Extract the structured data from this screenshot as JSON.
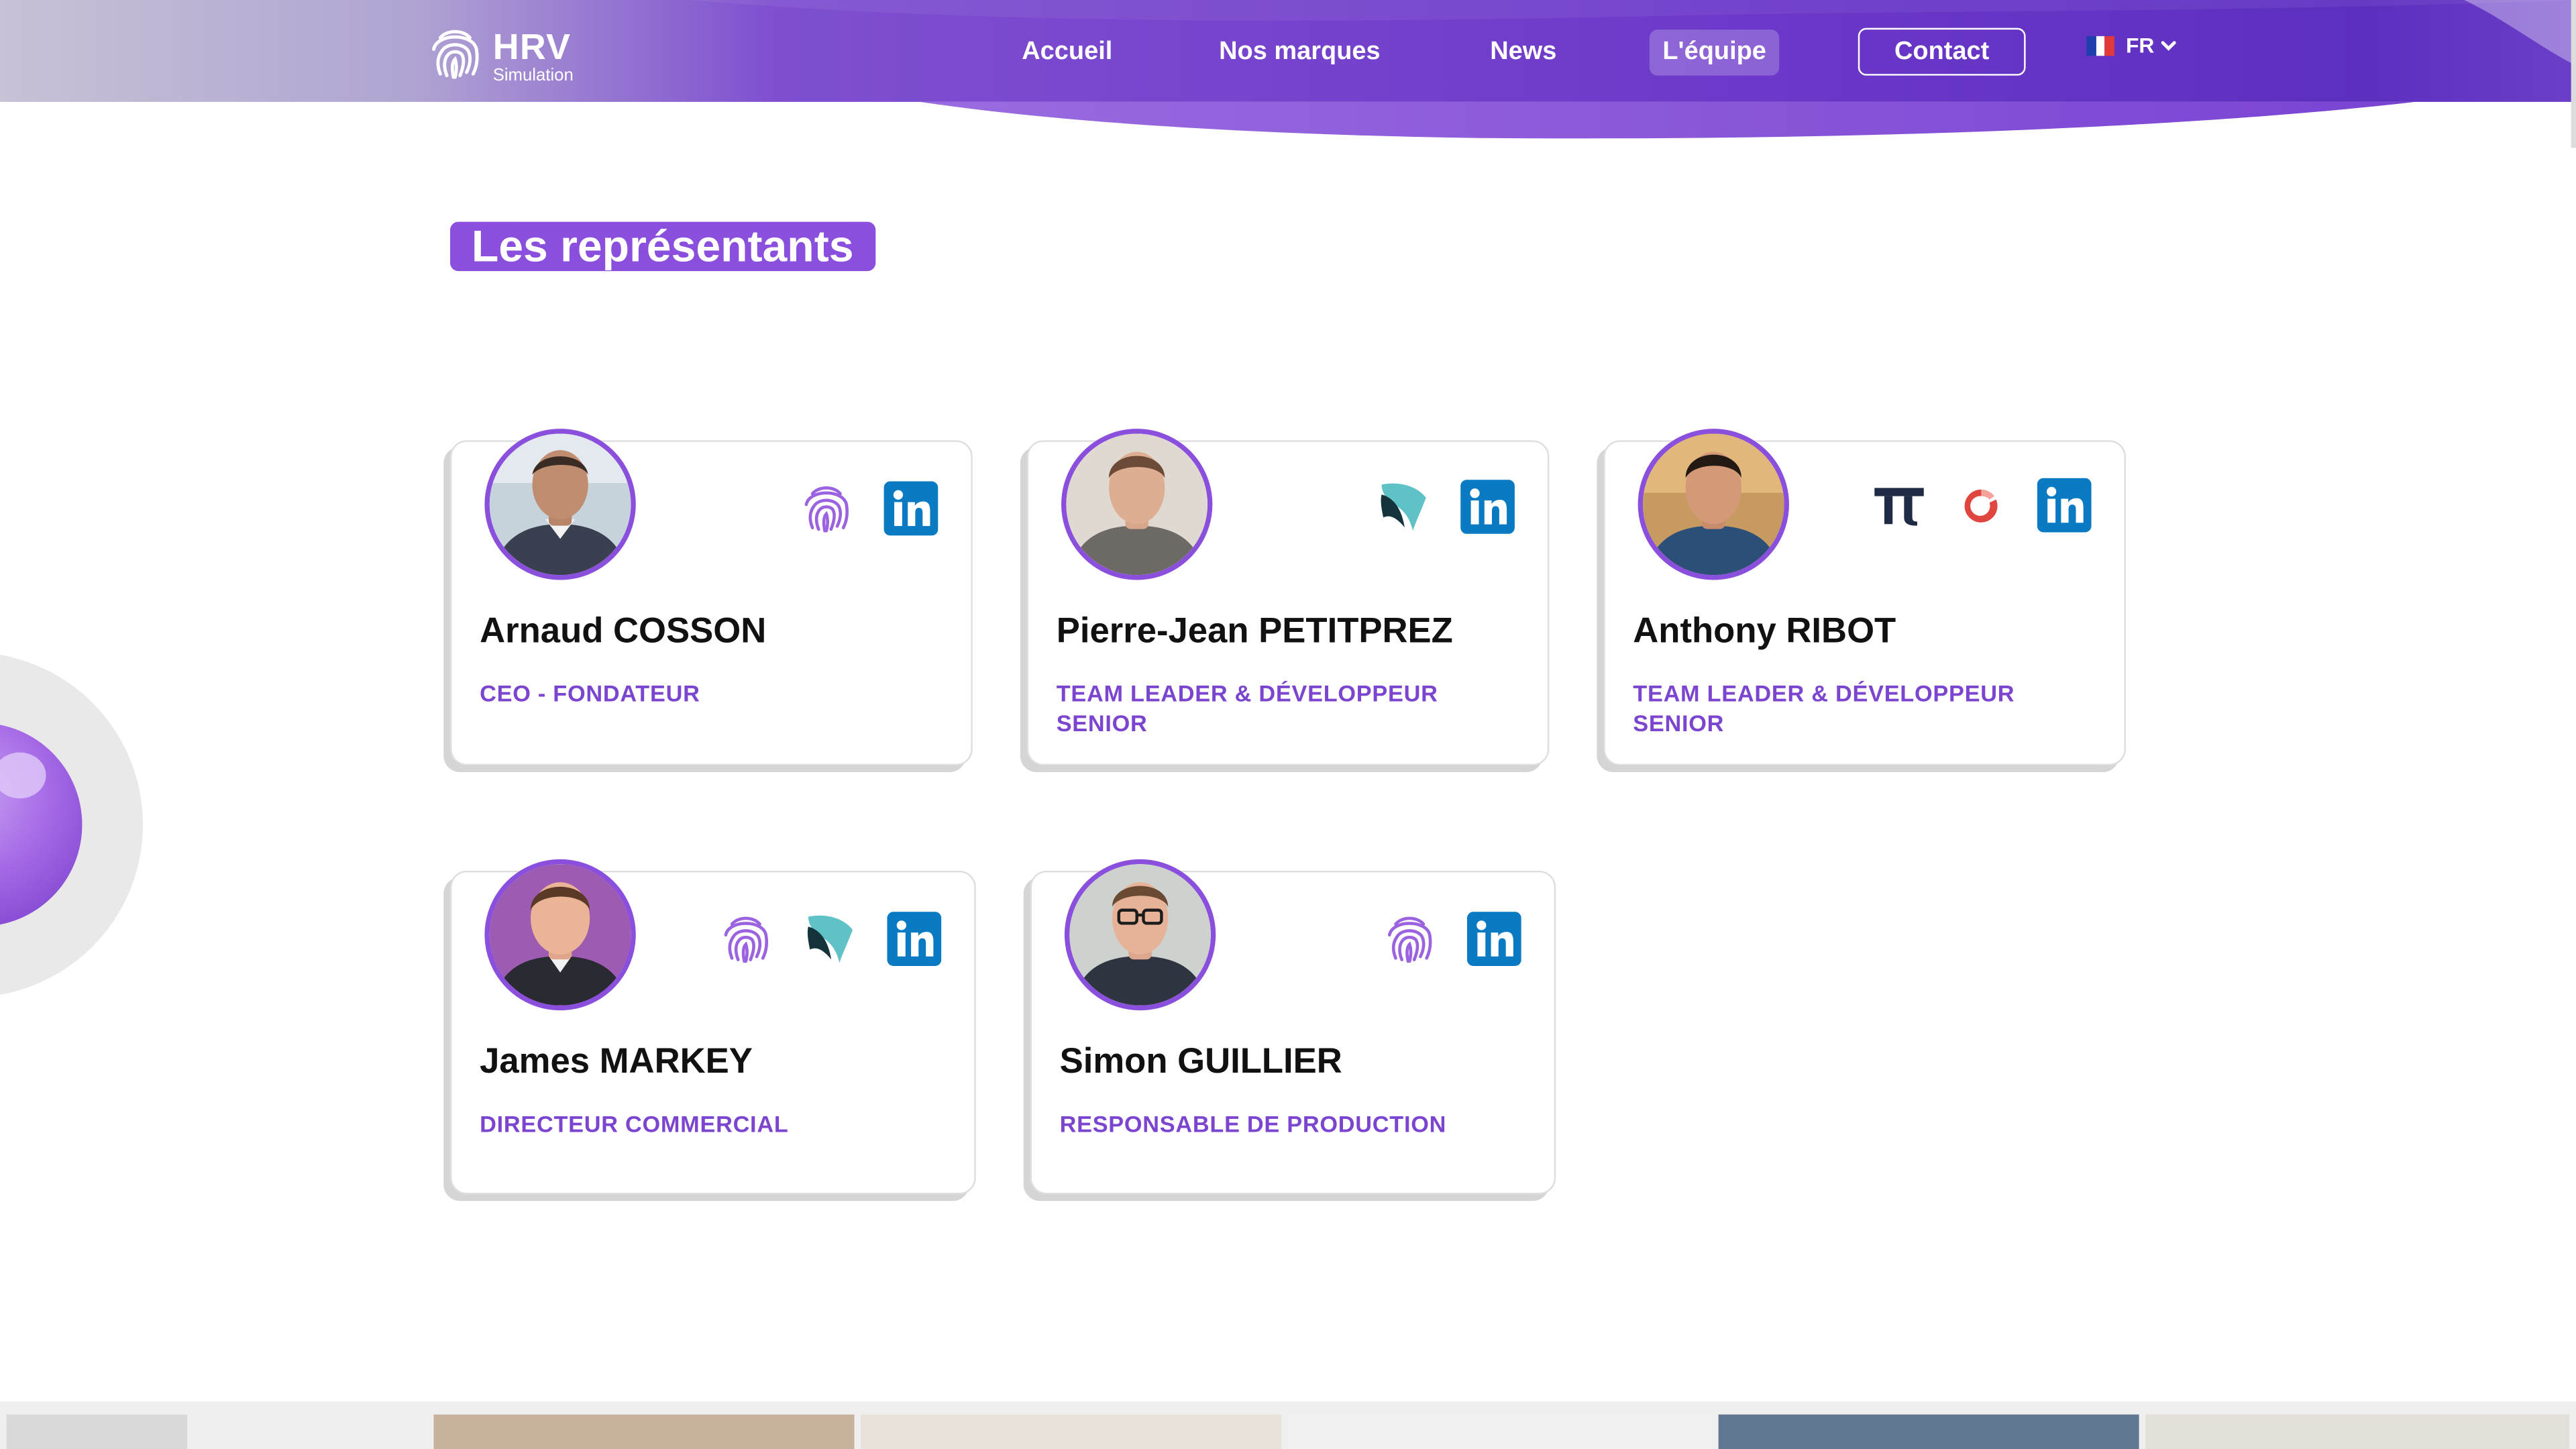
{
  "header": {
    "logo": {
      "main": "HRV",
      "sub": "Simulation",
      "icon": "fingerprint-icon"
    },
    "nav": {
      "home": "Accueil",
      "brands": "Nos marques",
      "news": "News",
      "team": "L'équipe",
      "contact": "Contact"
    },
    "language": {
      "code": "FR",
      "flag": "france-flag-icon",
      "chevron": "chevron-down-icon"
    }
  },
  "section": {
    "title": "Les représentants"
  },
  "members": [
    {
      "name": "Arnaud COSSON",
      "role": "CEO - FONDATEUR",
      "icons": [
        "fingerprint-icon",
        "linkedin-icon"
      ]
    },
    {
      "name": "Pierre-Jean PETITPREZ",
      "role": "TEAM LEADER & DÉVELOPPEUR SENIOR",
      "icons": [
        "shield-logo-icon",
        "linkedin-icon"
      ]
    },
    {
      "name": "Anthony RIBOT",
      "role": "TEAM LEADER & DÉVELOPPEUR SENIOR",
      "icons": [
        "pi-logo-icon",
        "swirl-logo-icon",
        "linkedin-icon"
      ]
    },
    {
      "name": "James MARKEY",
      "role": "DIRECTEUR COMMERCIAL",
      "icons": [
        "fingerprint-icon",
        "shield-logo-icon",
        "linkedin-icon"
      ]
    },
    {
      "name": "Simon GUILLIER",
      "role": "RESPONSABLE DE PRODUCTION",
      "icons": [
        "fingerprint-icon",
        "linkedin-icon"
      ]
    }
  ],
  "colors": {
    "brand": "#8a4fdc",
    "role_text": "#7b45cf",
    "header_purple": "#6a36c9",
    "linkedin": "#0a7ac2",
    "pi_logo": "#1f2a44",
    "swirl_logo": "#e0463f"
  }
}
